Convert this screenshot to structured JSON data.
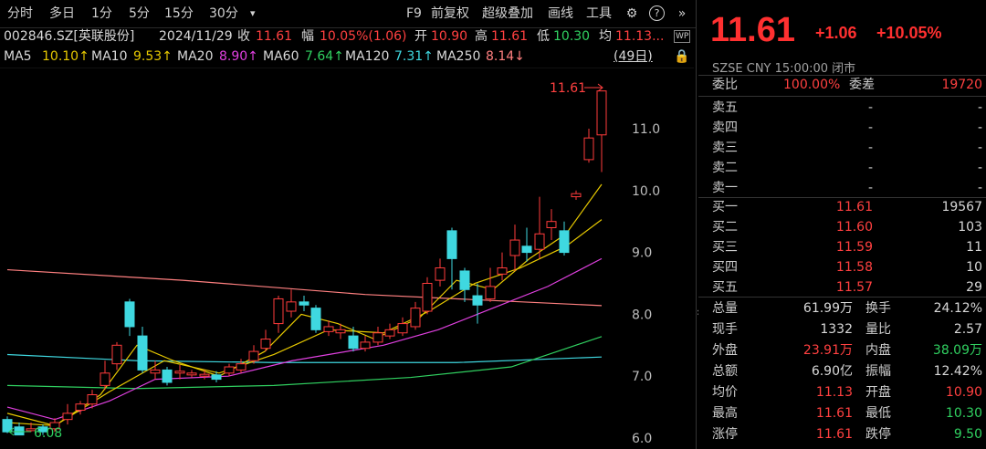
{
  "toolbar": {
    "tabs": [
      "分时",
      "多日",
      "1分",
      "5分",
      "15分",
      "30分"
    ],
    "dropdown_glyph": "▾",
    "right": [
      "F9",
      "前复权",
      "超级叠加",
      "画线",
      "工具"
    ],
    "icons": [
      "gear-icon",
      "help-icon",
      "collapse-icon"
    ]
  },
  "info": {
    "code": "002846.SZ[英联股份]",
    "date": "2024/11/29",
    "close_label": "收",
    "close": "11.61",
    "range_label": "幅",
    "range": "10.05%(1.06)",
    "open_label": "开",
    "open": "10.90",
    "high_label": "高",
    "high": "11.61",
    "low_label": "低",
    "low": "10.30",
    "avg_label": "均",
    "avg": "11.13...",
    "wp_badge": "WP"
  },
  "ma": [
    {
      "label": "MA5",
      "value": "10.10↑",
      "color": "#e6c800"
    },
    {
      "label": "MA10",
      "value": "9.53↑",
      "color": "#e6c800"
    },
    {
      "label": "MA20",
      "value": "8.90↑",
      "color": "#e040e0"
    },
    {
      "label": "MA60",
      "value": "7.64↑",
      "color": "#30d060"
    },
    {
      "label": "MA120",
      "value": "7.31↑",
      "color": "#3fd8e0"
    },
    {
      "label": "MA250",
      "value": "8.14↓",
      "color": "#ff8080"
    }
  ],
  "period": "(49日)",
  "chart_data": {
    "type": "candlestick",
    "y_ticks": [
      "11.0",
      "10.0",
      "9.0",
      "8.0",
      "7.0",
      "6.0"
    ],
    "high_marker": "11.61",
    "low_marker": "6.08"
  },
  "quote": {
    "price": "11.61",
    "change": "+1.06",
    "change_pct": "+10.05%",
    "sub": "SZSE  CNY  15:00:00  闭市",
    "weibi_label": "委比",
    "weibi": "100.00%",
    "weicha_label": "委差",
    "weicha": "19720",
    "sells": [
      {
        "label": "卖五",
        "price": "-",
        "vol": "-"
      },
      {
        "label": "卖四",
        "price": "-",
        "vol": "-"
      },
      {
        "label": "卖三",
        "price": "-",
        "vol": "-"
      },
      {
        "label": "卖二",
        "price": "-",
        "vol": "-"
      },
      {
        "label": "卖一",
        "price": "-",
        "vol": "-"
      }
    ],
    "buys": [
      {
        "label": "买一",
        "price": "11.61",
        "vol": "19567"
      },
      {
        "label": "买二",
        "price": "11.60",
        "vol": "103"
      },
      {
        "label": "买三",
        "price": "11.59",
        "vol": "11"
      },
      {
        "label": "买四",
        "price": "11.58",
        "vol": "10"
      },
      {
        "label": "买五",
        "price": "11.57",
        "vol": "29"
      }
    ],
    "stats": [
      {
        "l1": "总量",
        "v1": "61.99万",
        "c1": "#d8d8d8",
        "l2": "换手",
        "v2": "24.12%",
        "c2": "#d8d8d8"
      },
      {
        "l1": "现手",
        "v1": "1332",
        "c1": "#d8d8d8",
        "l2": "量比",
        "v2": "2.57",
        "c2": "#d8d8d8"
      },
      {
        "l1": "外盘",
        "v1": "23.91万",
        "c1": "#ff4040",
        "l2": "内盘",
        "v2": "38.09万",
        "c2": "#30d060"
      },
      {
        "l1": "总额",
        "v1": "6.90亿",
        "c1": "#d8d8d8",
        "l2": "振幅",
        "v2": "12.42%",
        "c2": "#d8d8d8"
      },
      {
        "l1": "均价",
        "v1": "11.13",
        "c1": "#ff4040",
        "l2": "开盘",
        "v2": "10.90",
        "c2": "#ff4040"
      },
      {
        "l1": "最高",
        "v1": "11.61",
        "c1": "#ff4040",
        "l2": "最低",
        "v2": "10.30",
        "c2": "#30d060"
      },
      {
        "l1": "涨停",
        "v1": "11.61",
        "c1": "#ff4040",
        "l2": "跌停",
        "v2": "9.50",
        "c2": "#30d060"
      }
    ]
  }
}
